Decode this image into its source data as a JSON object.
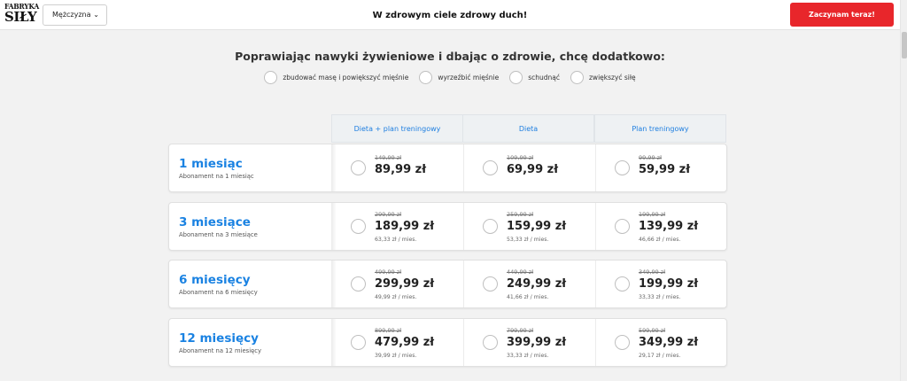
{
  "header": {
    "logo_line1": "FABRYKA",
    "logo_line2": "SIŁY",
    "gender_selected": "Mężczyzna",
    "slogan": "W zdrowym ciele zdrowy duch!",
    "cta_label": "Zaczynam teraz!"
  },
  "goals": {
    "title": "Poprawiając nawyki żywieniowe i dbając o zdrowie, chcę dodatkowo:",
    "options": [
      {
        "label": "zbudować masę i powiększyć mięśnie"
      },
      {
        "label": "wyrzeźbić mięśnie"
      },
      {
        "label": "schudnąć"
      },
      {
        "label": "zwiększyć siłę"
      }
    ]
  },
  "columns": [
    {
      "label": "Dieta + plan treningowy"
    },
    {
      "label": "Dieta"
    },
    {
      "label": "Plan treningowy"
    }
  ],
  "plans": [
    {
      "title": "1 miesiąc",
      "subtitle": "Abonament na 1 miesiąc",
      "cells": [
        {
          "old": "149,99 zł",
          "price": "89,99 zł",
          "per": ""
        },
        {
          "old": "109,99 zł",
          "price": "69,99 zł",
          "per": ""
        },
        {
          "old": "99,99 zł",
          "price": "59,99 zł",
          "per": ""
        }
      ]
    },
    {
      "title": "3 miesiące",
      "subtitle": "Abonament na 3 miesiące",
      "cells": [
        {
          "old": "299,99 zł",
          "price": "189,99 zł",
          "per": "63,33 zł / mies."
        },
        {
          "old": "259,99 zł",
          "price": "159,99 zł",
          "per": "53,33 zł / mies."
        },
        {
          "old": "199,99 zł",
          "price": "139,99 zł",
          "per": "46,66 zł / mies."
        }
      ]
    },
    {
      "title": "6 miesięcy",
      "subtitle": "Abonament na 6 miesięcy",
      "cells": [
        {
          "old": "499,99 zł",
          "price": "299,99 zł",
          "per": "49,99 zł / mies."
        },
        {
          "old": "449,99 zł",
          "price": "249,99 zł",
          "per": "41,66 zł / mies."
        },
        {
          "old": "349,99 zł",
          "price": "199,99 zł",
          "per": "33,33 zł / mies."
        }
      ]
    },
    {
      "title": "12 miesięcy",
      "subtitle": "Abonament na 12 miesięcy",
      "cells": [
        {
          "old": "899,99 zł",
          "price": "479,99 zł",
          "per": "39,99 zł / mies."
        },
        {
          "old": "799,99 zł",
          "price": "399,99 zł",
          "per": "33,33 zł / mies."
        },
        {
          "old": "599,99 zł",
          "price": "349,99 zł",
          "per": "29,17 zł / mies."
        }
      ]
    }
  ],
  "colors": {
    "accent_blue": "#1a82e2",
    "cta_red": "#e8262b"
  }
}
